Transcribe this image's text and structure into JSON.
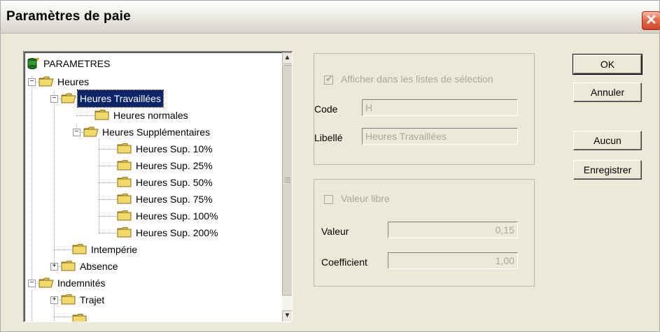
{
  "window": {
    "title": "Paramètres de paie"
  },
  "tree": {
    "items": [
      {
        "label": "PARAMETRES"
      },
      {
        "label": "Heures"
      },
      {
        "label": "Heures Travaillées"
      },
      {
        "label": "Heures normales"
      },
      {
        "label": "Heures Supplémentaires"
      },
      {
        "label": "Heures Sup. 10%"
      },
      {
        "label": "Heures Sup. 25%"
      },
      {
        "label": "Heures Sup. 50%"
      },
      {
        "label": "Heures Sup. 75%"
      },
      {
        "label": "Heures Sup. 100%"
      },
      {
        "label": "Heures Sup. 200%"
      },
      {
        "label": "Intempérie"
      },
      {
        "label": "Absence"
      },
      {
        "label": "Indemnités"
      },
      {
        "label": "Trajet"
      }
    ],
    "selected": "Heures Travaillées"
  },
  "details": {
    "show_in_lists_label": "Afficher dans les listes de sélection",
    "show_in_lists_checked": true,
    "code_label": "Code",
    "code_value": "H",
    "libelle_label": "Libellé",
    "libelle_value": "Heures Travaillées"
  },
  "value_group": {
    "free_value_label": "Valeur libre",
    "free_value_checked": false,
    "valeur_label": "Valeur",
    "valeur_value": "0,15",
    "coefficient_label": "Coefficient",
    "coefficient_value": "1,00"
  },
  "buttons": {
    "ok": "OK",
    "annuler": "Annuler",
    "aucun": "Aucun",
    "enregistrer": "Enregistrer"
  }
}
